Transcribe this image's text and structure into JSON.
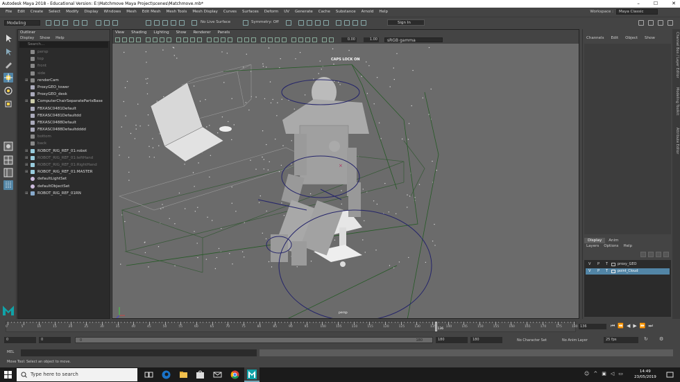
{
  "titlebar": {
    "title": "Autodesk Maya 2018 - Educational Version: E:\\Matchmove Maya Project\\scenes\\Matchmove.mb*",
    "minimize": "–",
    "maximize": "☐",
    "close": "✕"
  },
  "menubar": {
    "items": [
      "File",
      "Edit",
      "Create",
      "Select",
      "Modify",
      "Display",
      "Windows",
      "Mesh",
      "Edit Mesh",
      "Mesh Tools",
      "Mesh Display",
      "Curves",
      "Surfaces",
      "Deform",
      "UV",
      "Generate",
      "Cache",
      "Substance",
      "Arnold",
      "Help"
    ],
    "workspace_label": "Workspace :",
    "workspace_value": "Maya Classic"
  },
  "statusline": {
    "mode": "Modeling",
    "live_surface": "No Live Surface",
    "symmetry": "Symmetry: Off",
    "sign_in": "Sign In"
  },
  "outliner": {
    "title": "Outliner",
    "menu": [
      "Display",
      "Show",
      "Help"
    ],
    "search_placeholder": "Search...",
    "items": [
      {
        "label": "persp",
        "dim": true,
        "expand": "",
        "icon": "camera-icon"
      },
      {
        "label": "top",
        "dim": true,
        "expand": "",
        "icon": "camera-icon"
      },
      {
        "label": "front",
        "dim": true,
        "expand": "",
        "icon": "camera-icon"
      },
      {
        "label": "side",
        "dim": true,
        "expand": "",
        "icon": "camera-icon"
      },
      {
        "label": "renderCam",
        "dim": false,
        "expand": "⊞",
        "icon": "camera-icon"
      },
      {
        "label": "ProxyGEO_tower",
        "dim": false,
        "expand": "",
        "icon": "mesh-icon"
      },
      {
        "label": "ProxyGEO_desk",
        "dim": false,
        "expand": "",
        "icon": "mesh-icon"
      },
      {
        "label": "ComputerChairSeparatePartsBase",
        "dim": false,
        "expand": "⊞",
        "icon": "group-icon"
      },
      {
        "label": "FBXASC0481Default",
        "dim": false,
        "expand": "",
        "icon": "mesh-icon"
      },
      {
        "label": "FBXASC0481Defaultdd",
        "dim": false,
        "expand": "",
        "icon": "mesh-icon"
      },
      {
        "label": "FBXASC0488Default",
        "dim": false,
        "expand": "",
        "icon": "mesh-icon"
      },
      {
        "label": "FBXASC0488Defaultdddd",
        "dim": false,
        "expand": "",
        "icon": "mesh-icon"
      },
      {
        "label": "bottom",
        "dim": true,
        "expand": "",
        "icon": "camera-icon"
      },
      {
        "label": "back",
        "dim": true,
        "expand": "",
        "icon": "camera-icon"
      },
      {
        "label": "ROBOT_RIG_REF_01:robot",
        "dim": false,
        "expand": "⊞",
        "icon": "joint-icon"
      },
      {
        "label": "ROBOT_RIG_REF_01:leftHand",
        "dim": true,
        "expand": "⊞",
        "icon": "joint-icon"
      },
      {
        "label": "ROBOT_RIG_REF_01:RightHand",
        "dim": true,
        "expand": "⊞",
        "icon": "joint-icon"
      },
      {
        "label": "ROBOT_RIG_REF_01:MASTER",
        "dim": false,
        "expand": "⊞",
        "icon": "joint-icon"
      },
      {
        "label": "defaultLightSet",
        "dim": false,
        "expand": "",
        "icon": "set-icon"
      },
      {
        "label": "defaultObjectSet",
        "dim": false,
        "expand": "",
        "icon": "set-icon"
      },
      {
        "label": "ROBOT_RIG_REF_01RN",
        "dim": false,
        "expand": "⊞",
        "icon": "reference-icon"
      }
    ]
  },
  "viewport": {
    "menu": [
      "View",
      "Shading",
      "Lighting",
      "Show",
      "Renderer",
      "Panels"
    ],
    "near_value": "0.00",
    "far_value": "1.00",
    "color_space": "sRGB gamma",
    "caps_lock": "CAPS LOCK ON",
    "camera_label": "persp"
  },
  "channelbox": {
    "menu": [
      "Channels",
      "Edit",
      "Object",
      "Show"
    ],
    "tabs": [
      "Display",
      "Anim"
    ],
    "layer_menu": [
      "Layers",
      "Options",
      "Help"
    ],
    "layers": [
      {
        "v": "V",
        "p": "P",
        "t": "T",
        "name": "proxy_GEO",
        "selected": false
      },
      {
        "v": "V",
        "p": "P",
        "t": "T",
        "name": "point_Cloud",
        "selected": true
      }
    ]
  },
  "sidetabs": [
    "Channel Box / Layer Editor",
    "Modeling Toolkit",
    "Attribute Editor"
  ],
  "timeslider": {
    "ticks": [
      "0",
      "5",
      "10",
      "15",
      "20",
      "25",
      "30",
      "35",
      "40",
      "45",
      "50",
      "55",
      "60",
      "65",
      "70",
      "75",
      "80",
      "85",
      "90",
      "95",
      "100",
      "105",
      "110",
      "115",
      "120",
      "125",
      "130",
      "135",
      "140",
      "145",
      "150",
      "155",
      "160",
      "165",
      "170",
      "175",
      "180"
    ],
    "current_frame": "136",
    "current_marker": "136",
    "playback_controls": [
      "⏮",
      "⏪",
      "◀",
      "▶",
      "⏩",
      "⏭"
    ]
  },
  "rangeslider": {
    "start": "0",
    "playback_start": "0",
    "range_left": "0",
    "range_right": "180",
    "playback_end": "180",
    "end": "180",
    "character_set": "No Character Set",
    "anim_layer": "No Anim Layer",
    "fps": "25 fps"
  },
  "cmdline": {
    "language": "MEL"
  },
  "helpline": {
    "text": "Move Tool: Select an object to move."
  },
  "taskbar": {
    "search_placeholder": "Type here to search",
    "time": "14:49",
    "date": "23/05/2019"
  },
  "colors": {
    "selection_blue": "#5285a6",
    "viewport_gray": "#6b6b6b",
    "maya_teal": "#10a3a8"
  }
}
